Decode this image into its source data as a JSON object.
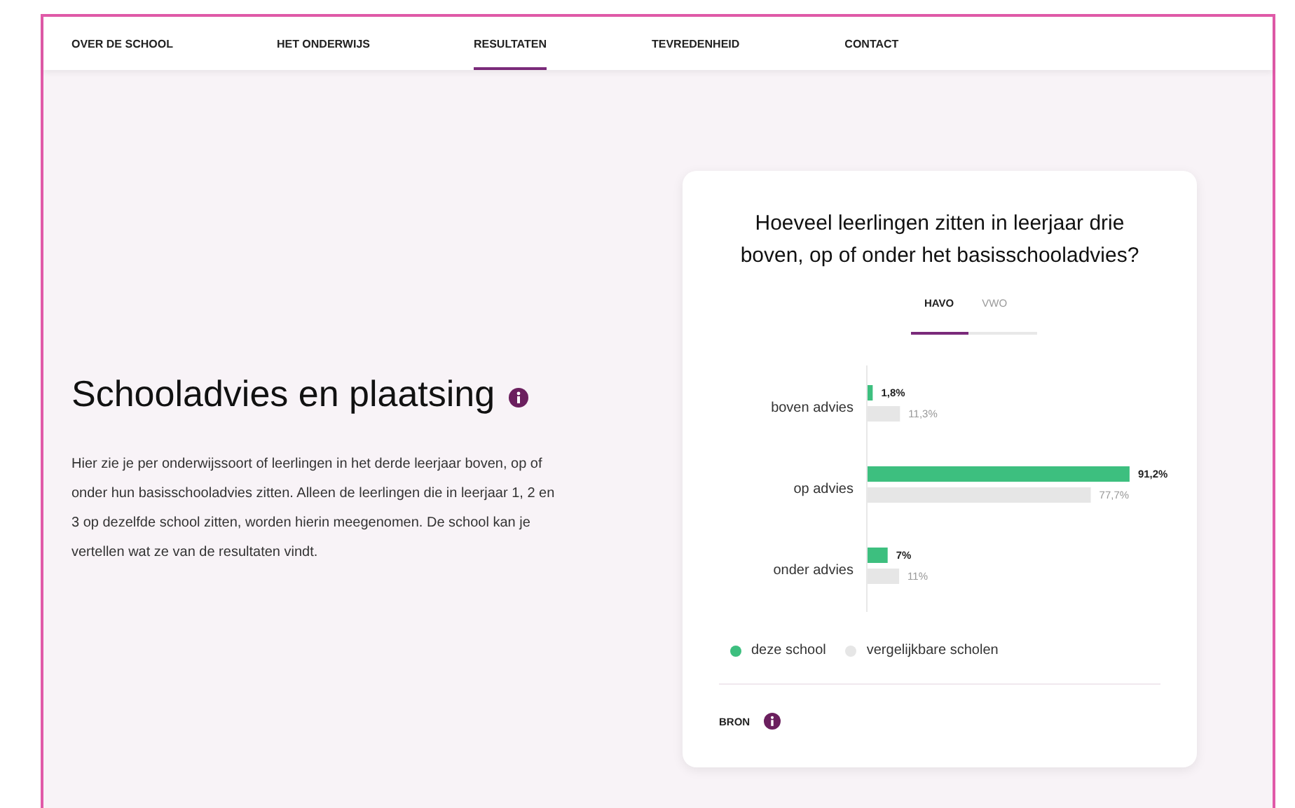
{
  "nav": [
    {
      "label": "OVER DE SCHOOL",
      "selected": false
    },
    {
      "label": "HET ONDERWIJS",
      "selected": false
    },
    {
      "label": "RESULTATEN",
      "selected": true
    },
    {
      "label": "TEVREDENHEID",
      "selected": false
    },
    {
      "label": "CONTACT",
      "selected": false
    }
  ],
  "section": {
    "title": "Schooladvies en plaatsing",
    "text": "Hier zie je per onderwijssoort of leerlingen in het derde leerjaar boven, op of onder hun basisschooladvies zitten. Alleen de leerlingen die in leerjaar 1, 2 en 3 op dezelfde school zitten, worden hierin meegenomen. De school kan je vertellen wat ze van de resultaten vindt."
  },
  "card": {
    "title": "Hoeveel leerlingen zitten in leerjaar drie boven, op of onder het basisschooladvies?",
    "tabs": [
      {
        "label": "HAVO",
        "selected": true
      },
      {
        "label": "VWO",
        "selected": false
      }
    ],
    "chart_data": {
      "type": "bar",
      "orientation": "horizontal",
      "categories": [
        "boven advies",
        "op advies",
        "onder advies"
      ],
      "data_labels": true,
      "series": [
        {
          "name": "deze school",
          "color": "#3dbf7f",
          "values": [
            1.8,
            91.2,
            7
          ],
          "value_labels": [
            "1,8%",
            "91,2%",
            "7%"
          ]
        },
        {
          "name": "vergelijkbare scholen",
          "color": "#e6e6e6",
          "values": [
            11.3,
            77.7,
            11
          ],
          "value_labels": [
            "11,3%",
            "77,7%",
            "11%"
          ]
        }
      ]
    },
    "source": "BRON"
  }
}
